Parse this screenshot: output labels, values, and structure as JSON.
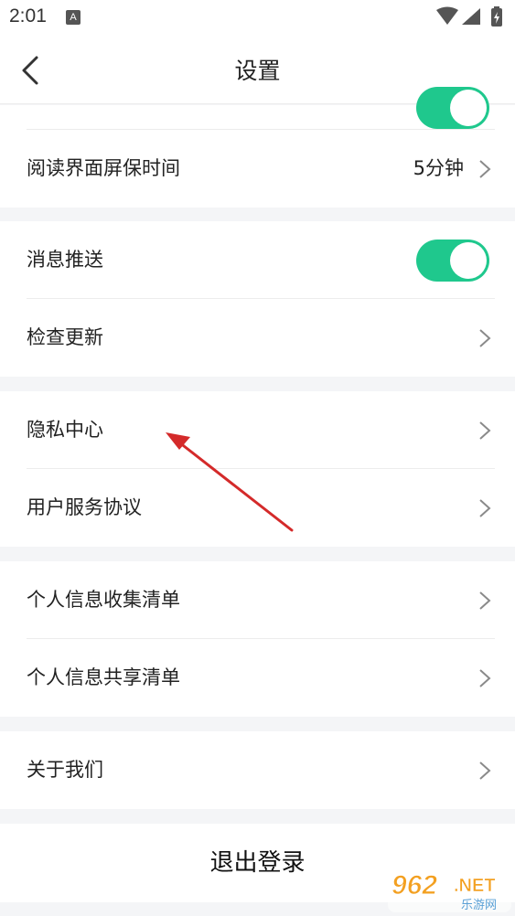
{
  "status_bar": {
    "time": "2:01",
    "notification_icon": "a-icon"
  },
  "header": {
    "title": "设置",
    "back_icon": "chevron-left-icon"
  },
  "colors": {
    "toggle_on": "#1fc88d",
    "arrow": "#d42a2a",
    "chevron": "#8a8a8a"
  },
  "settings": {
    "hidden_toggle_on": true,
    "screensaver": {
      "label": "阅读界面屏保时间",
      "value": "5分钟"
    },
    "push": {
      "label": "消息推送",
      "enabled": true
    },
    "update": {
      "label": "检查更新"
    },
    "privacy": {
      "label": "隐私中心"
    },
    "agreement": {
      "label": "用户服务协议"
    },
    "info_collect": {
      "label": "个人信息收集清单"
    },
    "info_share": {
      "label": "个人信息共享清单"
    },
    "about": {
      "label": "关于我们"
    }
  },
  "logout": {
    "label": "退出登录"
  },
  "watermark": {
    "number": "962",
    "suffix": ".NET",
    "sub": "乐游网"
  }
}
